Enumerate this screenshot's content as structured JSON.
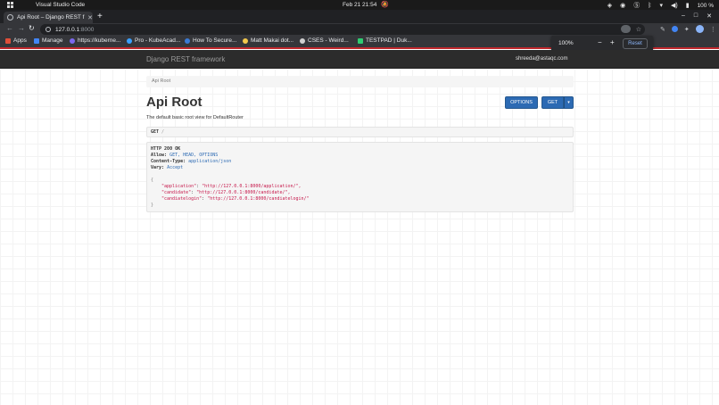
{
  "os": {
    "app_name": "Visual Studio Code",
    "clock": "Feb 21  21:54",
    "battery": "100 %"
  },
  "browser": {
    "tab_title": "Api Root – Django REST f",
    "url_host": "127.0.0.1",
    "url_port": ":8000",
    "bookmarks": [
      {
        "label": "Apps",
        "color": "#e04e39"
      },
      {
        "label": "Manage",
        "color": "#4285f4"
      },
      {
        "label": "https://kuberne...",
        "color": "#7b68ee"
      },
      {
        "label": "Pro - KubeAcad...",
        "color": "#3aa0ff"
      },
      {
        "label": "How To Secure...",
        "color": "#3b7bd6"
      },
      {
        "label": "Matt Makai dot...",
        "color": "#f2c84b"
      },
      {
        "label": "CSES - Weird...",
        "color": "#d0d0d0"
      },
      {
        "label": "TESTPAD | Duk...",
        "color": "#2ecc71"
      }
    ],
    "zoom_popup": {
      "level": "100%",
      "minus": "−",
      "plus": "+",
      "reset": "Reset"
    }
  },
  "page": {
    "brand": "Django REST framework",
    "user": "shreeda@astaqc.com",
    "breadcrumb": "Api Root",
    "title": "Api Root",
    "description": "The default basic root view for DefaultRouter",
    "buttons": {
      "options": "OPTIONS",
      "get": "GET",
      "caret": "▾"
    },
    "request": {
      "method": "GET",
      "path": "/"
    },
    "response": {
      "status": "HTTP 200 OK",
      "allow_label": "Allow:",
      "allow_value": "GET, HEAD, OPTIONS",
      "content_type_label": "Content-Type:",
      "content_type_value": "application/json",
      "vary_label": "Vary:",
      "vary_value": "Accept",
      "open_brace": "{",
      "close_brace": "}",
      "entries": [
        {
          "key": "\"application\"",
          "value": "\"http://127.0.0.1:8000/application/\","
        },
        {
          "key": "\"candidate\"",
          "value": "\"http://127.0.0.1:8000/candidate/\","
        },
        {
          "key": "\"candiatelogin\"",
          "value": "\"http://127.0.0.1:8000/candiatelogin/\""
        }
      ]
    }
  }
}
